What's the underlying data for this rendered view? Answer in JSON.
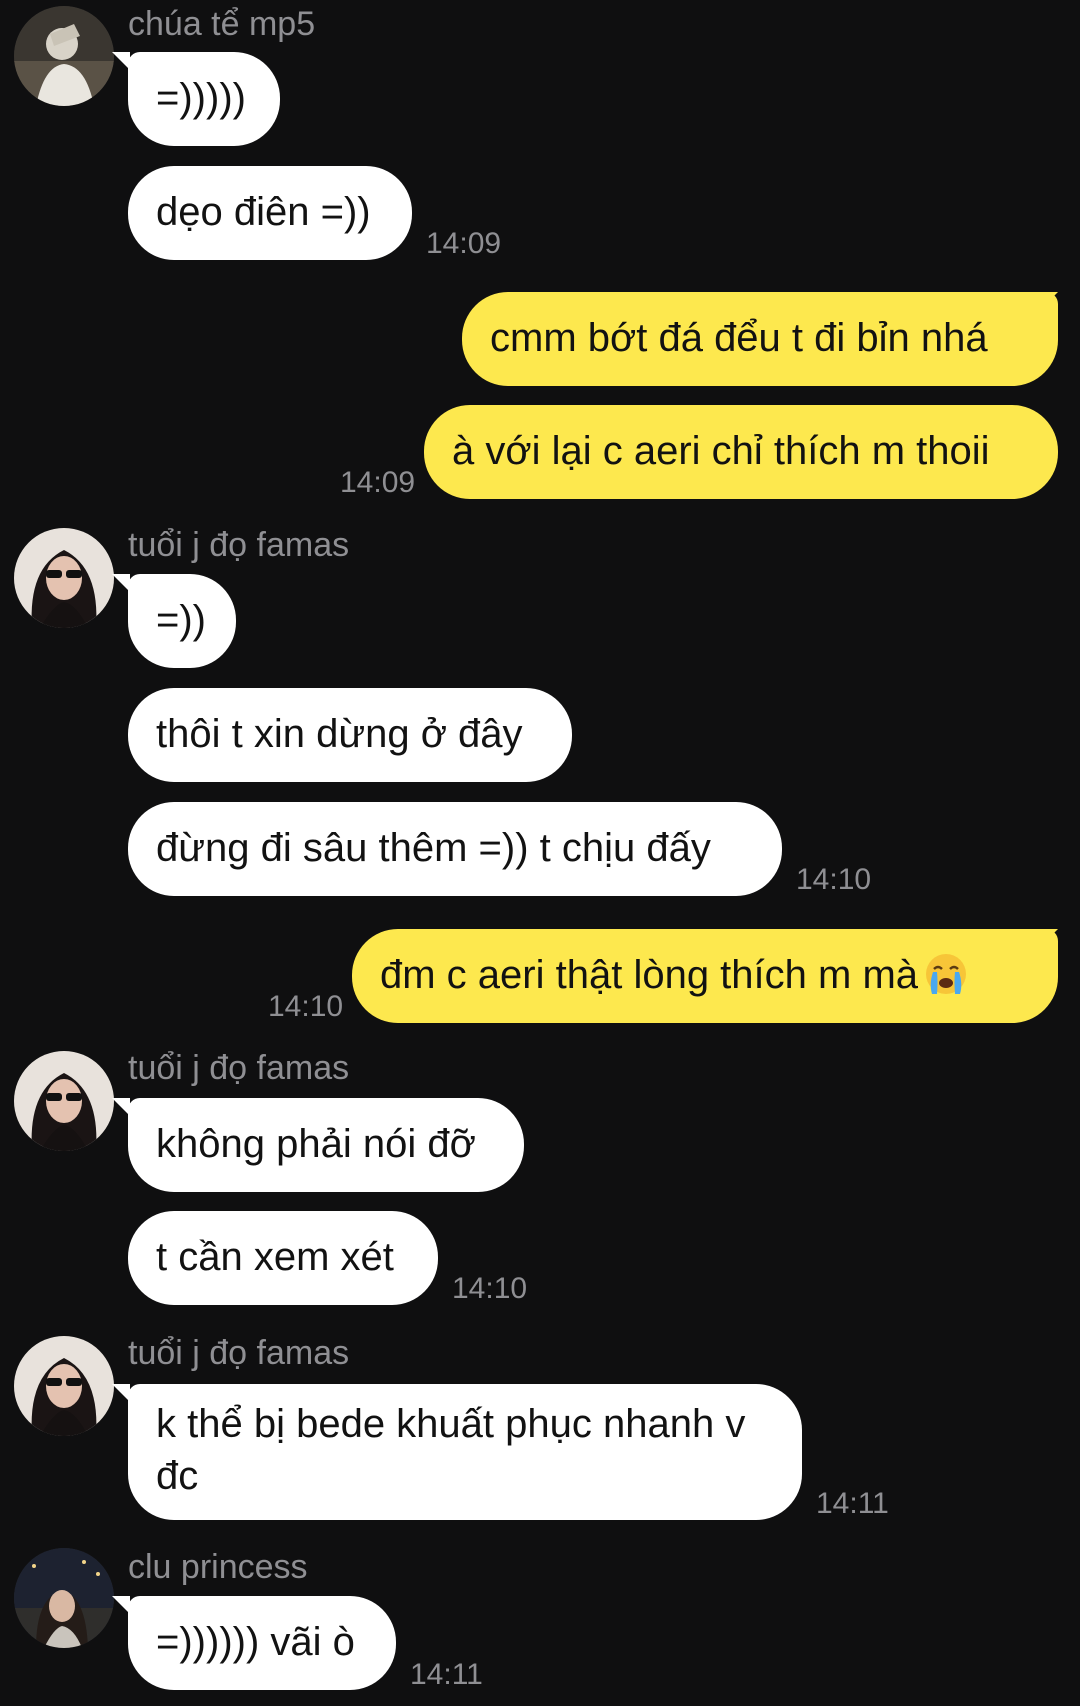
{
  "messages": [
    {
      "sender": "chúa tể mp5",
      "texts": [
        "=)))))",
        "dẹo điên =))"
      ],
      "time": "14:09"
    },
    {
      "sender": "me",
      "texts": [
        "cmm bớt đá đểu t đi bỉn nhá",
        "à với lại c aeri chỉ thích m thoii"
      ],
      "time": "14:09"
    },
    {
      "sender": "tuổi j đọ famas",
      "texts": [
        "=))",
        "thôi t xin dừng ở đây",
        "đừng đi sâu thêm =)) t chịu đấy"
      ],
      "time": "14:10"
    },
    {
      "sender": "me",
      "texts": [
        "đm c aeri thật lòng thích m mà"
      ],
      "time": "14:10",
      "emoji": "crying-face-emoji"
    },
    {
      "sender": "tuổi j đọ famas",
      "texts": [
        "không phải nói đỡ",
        "t cần xem xét"
      ],
      "time": "14:10"
    },
    {
      "sender": "tuổi j đọ famas",
      "texts": [
        "k thể bị bede khuất phục nhanh v đc"
      ],
      "time": "14:11"
    },
    {
      "sender": "clu princess",
      "texts": [
        "=)))))) vãi ò"
      ],
      "time": "14:11"
    }
  ],
  "colors": {
    "background": "#0f0f10",
    "incoming_bubble": "#ffffff",
    "outgoing_bubble": "#fde84e",
    "meta_text": "#8f8f93"
  }
}
